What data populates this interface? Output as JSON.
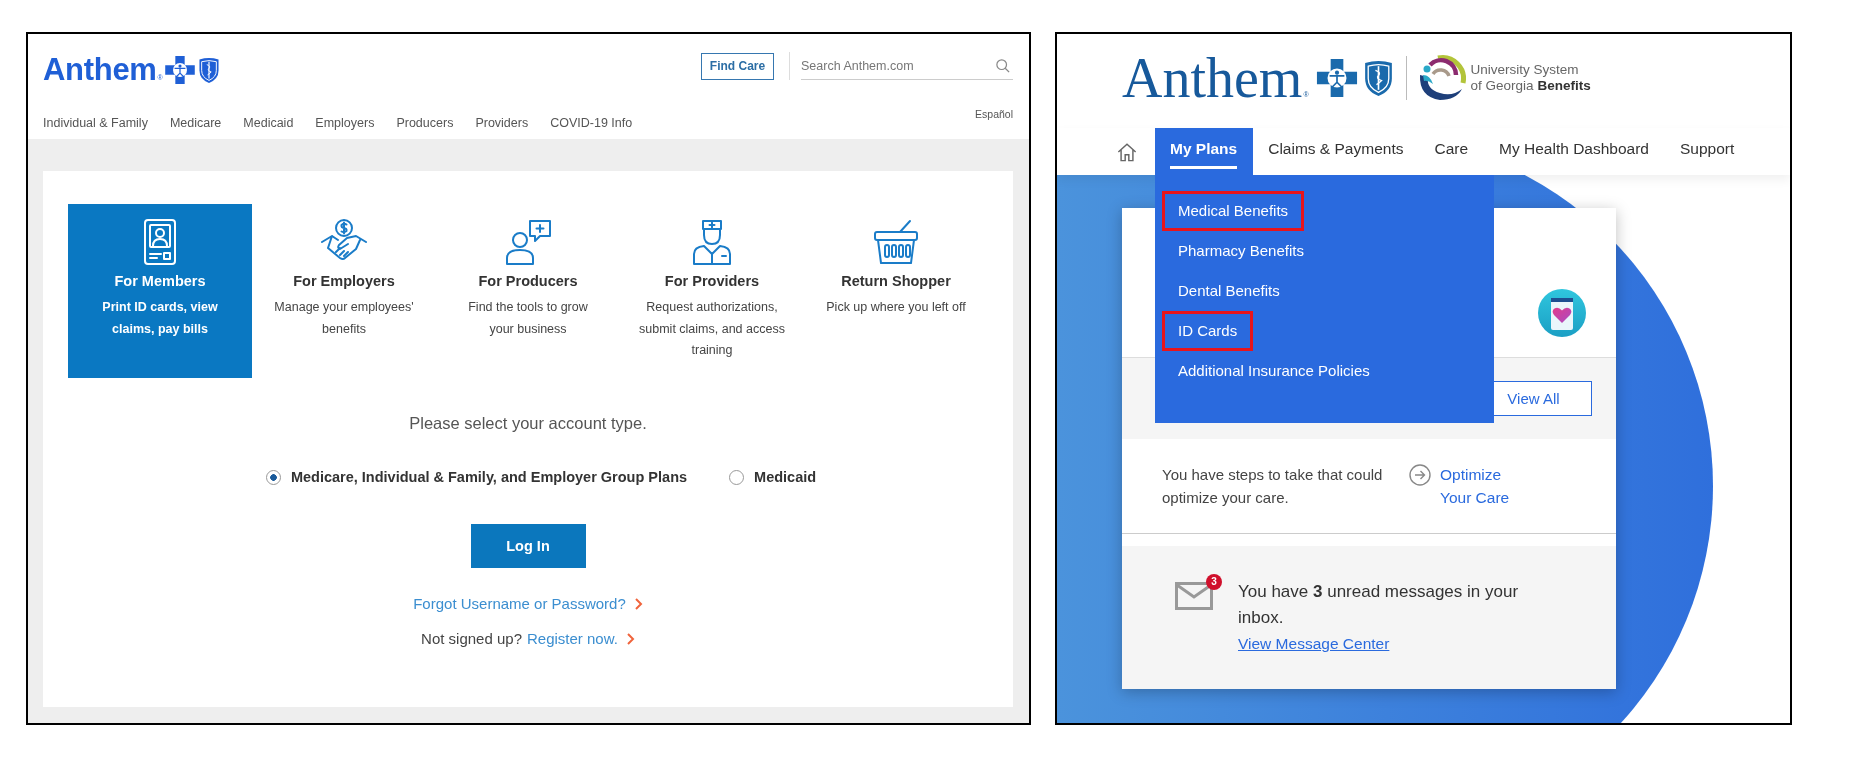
{
  "left_panel": {
    "header": {
      "logo": "Anthem$_{®}$",
      "find_care_button": "Find Care",
      "search": {
        "placeholder": "Search Anthem.com"
      },
      "language_link": "Español"
    },
    "nav": [
      "Individual & Family",
      "Medicare",
      "Medicaid",
      "Employers",
      "Producers",
      "Providers",
      "COVID-19 Info"
    ],
    "tiles": [
      {
        "title": "For Members",
        "description": "Print ID cards, view claims, pay bills",
        "selected": true
      },
      {
        "title": "For Employers",
        "description": "Manage your employees' benefits",
        "selected": false
      },
      {
        "title": "For Producers",
        "description": "Find the tools to grow your business",
        "selected": false
      },
      {
        "title": "For Providers",
        "description": "Request authorizations, submit claims, and access training",
        "selected": false
      },
      {
        "title": "Return Shopper",
        "description": "Pick up where you left off",
        "selected": false
      }
    ],
    "prompt": "Please select your account type.",
    "account_types": [
      {
        "label": "Medicare, Individual & Family, and Employer Group Plans",
        "selected": true
      },
      {
        "label": "Medicaid",
        "selected": false
      }
    ],
    "login_button": "Log In",
    "forgot_link": "Forgot Username or Password?",
    "signup_text": "Not signed up?",
    "register_link": "Register now."
  },
  "right_panel": {
    "logo": "Anthem$_{®}$",
    "partner_lines": [
      "University System",
      "of Georgia **Benefits**"
    ],
    "nav": [
      {
        "label": "My Plans",
        "selected": true,
        "expanded": true,
        "menu": [
          {
            "label": "Medical Benefits",
            "highlighted": true
          },
          {
            "label": "Pharmacy Benefits",
            "highlighted": false
          },
          {
            "label": "Dental Benefits",
            "highlighted": false
          },
          {
            "label": "ID Cards",
            "highlighted": true
          },
          {
            "label": "Additional Insurance Policies",
            "highlighted": false
          }
        ]
      },
      {
        "label": "Claims & Payments",
        "selected": false,
        "expanded": false
      },
      {
        "label": "Care",
        "selected": false,
        "expanded": false
      },
      {
        "label": "My Health Dashboard",
        "selected": false,
        "expanded": false
      },
      {
        "label": "Support",
        "selected": false,
        "expanded": false
      }
    ],
    "card": {
      "view_all_button": "View All",
      "care_text": "You have steps to take that could optimize your care.",
      "care_link": "Optimize Your Care",
      "messages": {
        "badge": "3",
        "text": "You have **3** unread messages in your inbox.",
        "link": "View Message Center"
      }
    }
  }
}
